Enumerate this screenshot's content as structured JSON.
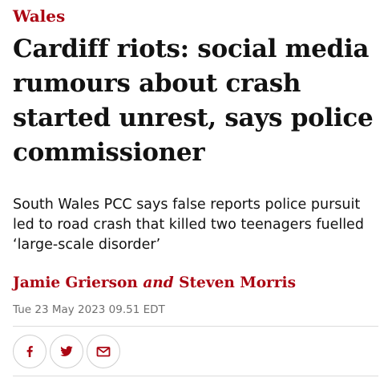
{
  "section": {
    "label": "Wales"
  },
  "article": {
    "headline": "Cardiff riots: social media rumours about crash started unrest, says police commissioner",
    "standfirst": "South Wales PCC says false reports police pursuit led to road crash that killed two teenagers fuelled ‘large-scale disorder’",
    "byline": {
      "author_1": "Jamie Grierson",
      "conjunction": "and",
      "author_2": "Steven Morris"
    },
    "date": "Tue 23 May 2023 09.51 EDT"
  },
  "share": {
    "buttons": [
      {
        "icon": "facebook-icon"
      },
      {
        "icon": "twitter-icon"
      },
      {
        "icon": "email-icon"
      }
    ]
  },
  "colors": {
    "accent": "#ab0613",
    "text": "#121212",
    "muted": "#707070",
    "rule": "#dcdcdc"
  }
}
